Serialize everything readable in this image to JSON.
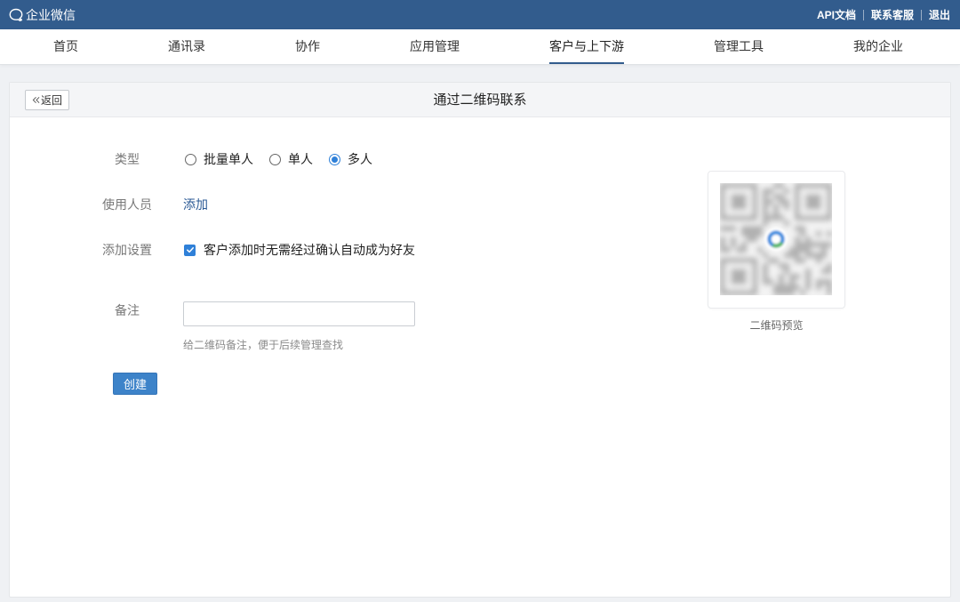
{
  "topbar": {
    "logo_icon": "chat-bubble-icon",
    "brand": "企业微信",
    "links": [
      {
        "label": "API文档"
      },
      {
        "label": "联系客服"
      },
      {
        "label": "退出"
      }
    ]
  },
  "nav": {
    "items": [
      {
        "label": "首页",
        "active": false
      },
      {
        "label": "通讯录",
        "active": false
      },
      {
        "label": "协作",
        "active": false
      },
      {
        "label": "应用管理",
        "active": false
      },
      {
        "label": "客户与上下游",
        "active": true
      },
      {
        "label": "管理工具",
        "active": false
      },
      {
        "label": "我的企业",
        "active": false
      }
    ]
  },
  "page": {
    "back_icon": "double-chevron-left-icon",
    "back_label": "返回",
    "title": "通过二维码联系"
  },
  "form": {
    "type": {
      "label": "类型",
      "options": [
        {
          "label": "批量单人",
          "selected": false
        },
        {
          "label": "单人",
          "selected": false
        },
        {
          "label": "多人",
          "selected": true
        }
      ]
    },
    "users": {
      "label": "使用人员",
      "add_link": "添加"
    },
    "settings": {
      "label": "添加设置",
      "checkbox_label": "客户添加时无需经过确认自动成为好友",
      "checked": true
    },
    "remark": {
      "label": "备注",
      "value": "",
      "hint": "给二维码备注，便于后续管理查找"
    },
    "create_label": "创建"
  },
  "qr_preview": {
    "label": "二维码预览"
  },
  "colors": {
    "topbar": "#325c8d",
    "accent": "#2f80d8",
    "link": "#2b5a95",
    "button": "#3d83c9"
  }
}
